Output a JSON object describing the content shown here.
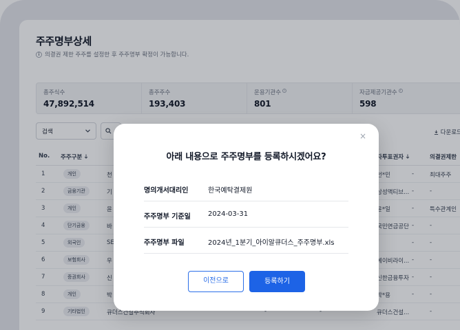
{
  "page": {
    "title": "주주명부상세",
    "description": "의결권 제한 주주를 설정한 후 주주명부 확정이 가능합니다."
  },
  "stats": [
    {
      "label": "총주식수",
      "value": "47,892,514",
      "has_info": false
    },
    {
      "label": "총주주수",
      "value": "193,403",
      "has_info": false
    },
    {
      "label": "운용기관수",
      "value": "801",
      "has_info": true
    },
    {
      "label": "자금제공기관수",
      "value": "598",
      "has_info": true
    }
  ],
  "toolbar": {
    "filter_label": "검색",
    "download_label": "다운로드"
  },
  "table": {
    "headers": {
      "no": "No.",
      "type": "주주구분",
      "agent": "자투표권자",
      "voting": "의결권제한"
    },
    "rows": [
      {
        "no": "1",
        "badge": "개인",
        "name": "천",
        "agent": "천*민",
        "dash": "-",
        "voting": "최대주주"
      },
      {
        "no": "2",
        "badge": "금융기관",
        "name": "기",
        "agent": "삼성액티브...",
        "dash": "-",
        "voting": "-"
      },
      {
        "no": "3",
        "badge": "개인",
        "name": "윤",
        "agent": "윤*일",
        "dash": "-",
        "voting": "특수관계인"
      },
      {
        "no": "4",
        "badge": "단기금융",
        "name": "바",
        "agent": "국민연금공단",
        "dash": "-",
        "voting": "-"
      },
      {
        "no": "5",
        "badge": "외국인",
        "name": "SE",
        "agent": "-",
        "dash": "-",
        "voting": "-"
      },
      {
        "no": "6",
        "badge": "보험회사",
        "name": "우",
        "agent": "에이비라이...",
        "dash": "-",
        "voting": "-"
      },
      {
        "no": "7",
        "badge": "증권회사",
        "name": "신",
        "agent": "신한금융투자",
        "dash": "-",
        "voting": "-"
      },
      {
        "no": "8",
        "badge": "개인",
        "name": "박",
        "agent": "박*용",
        "dash": "-",
        "voting": "-"
      },
      {
        "no": "9",
        "badge": "기타법인",
        "name": "큐더스건설주식회사",
        "agent": "큐더스건설...",
        "dash": "-",
        "voting": "-"
      }
    ]
  },
  "modal": {
    "title": "아래 내용으로 주주명부를 등록하시겠어요?",
    "close_symbol": "×",
    "fields": [
      {
        "label": "명의개서대리인",
        "value": "한국예탁결제원"
      },
      {
        "label": "주주명부 기준일",
        "value": "2024-03-31"
      },
      {
        "label": "주주명부 파일",
        "value": "2024년_1분기_아이알큐더스_주주명부.xls"
      }
    ],
    "prev_label": "이전으로",
    "register_label": "등록하기"
  },
  "colors": {
    "primary": "#1d63e6",
    "frame": "#e3e5ea"
  }
}
